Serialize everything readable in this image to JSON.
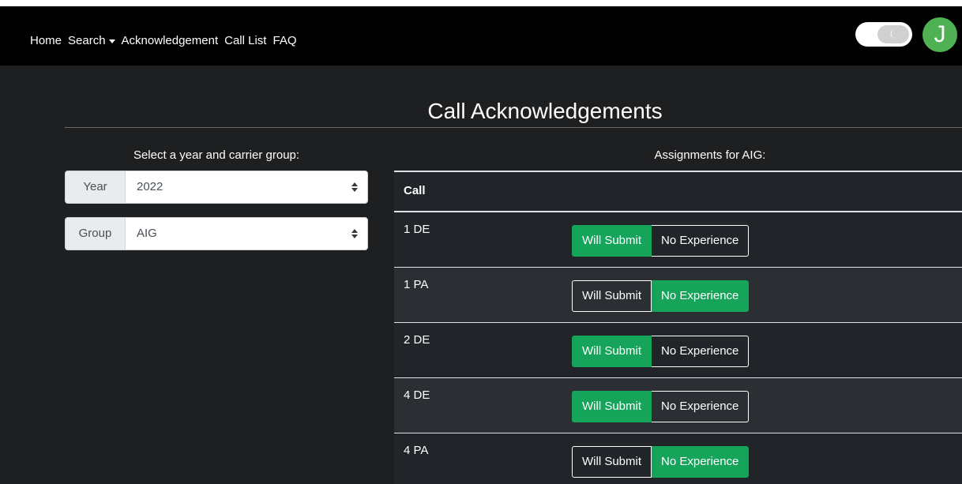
{
  "nav": {
    "items": [
      {
        "label": "Home",
        "name": "nav-home"
      },
      {
        "label": "Search",
        "name": "nav-search"
      },
      {
        "label": "Acknowledgement",
        "name": "nav-acknowledgement"
      },
      {
        "label": "Call List",
        "name": "nav-call-list"
      },
      {
        "label": "FAQ",
        "name": "nav-faq"
      }
    ],
    "avatar_letter": "J"
  },
  "page": {
    "title": "Call Acknowledgements"
  },
  "filters": {
    "heading": "Select a year and carrier group:",
    "year_label": "Year",
    "year_value": "2022",
    "group_label": "Group",
    "group_value": "AIG"
  },
  "assignments": {
    "heading": "Assignments for AIG:",
    "column_header": "Call",
    "option_labels": [
      "Will Submit",
      "No Experience"
    ],
    "rows": [
      {
        "call": "1 DE",
        "selected": "Will Submit"
      },
      {
        "call": "1 PA",
        "selected": "No Experience"
      },
      {
        "call": "2 DE",
        "selected": "Will Submit"
      },
      {
        "call": "4 DE",
        "selected": "Will Submit"
      },
      {
        "call": "4 PA",
        "selected": "No Experience"
      }
    ]
  },
  "colors": {
    "active_button": "#16a35a",
    "avatar": "#4fb054",
    "navbar": "#000000",
    "background": "#1e1f21"
  },
  "icons": {
    "theme_toggle": "moon-icon",
    "select": "select-arrows-icon",
    "dropdown": "caret-down-icon"
  }
}
